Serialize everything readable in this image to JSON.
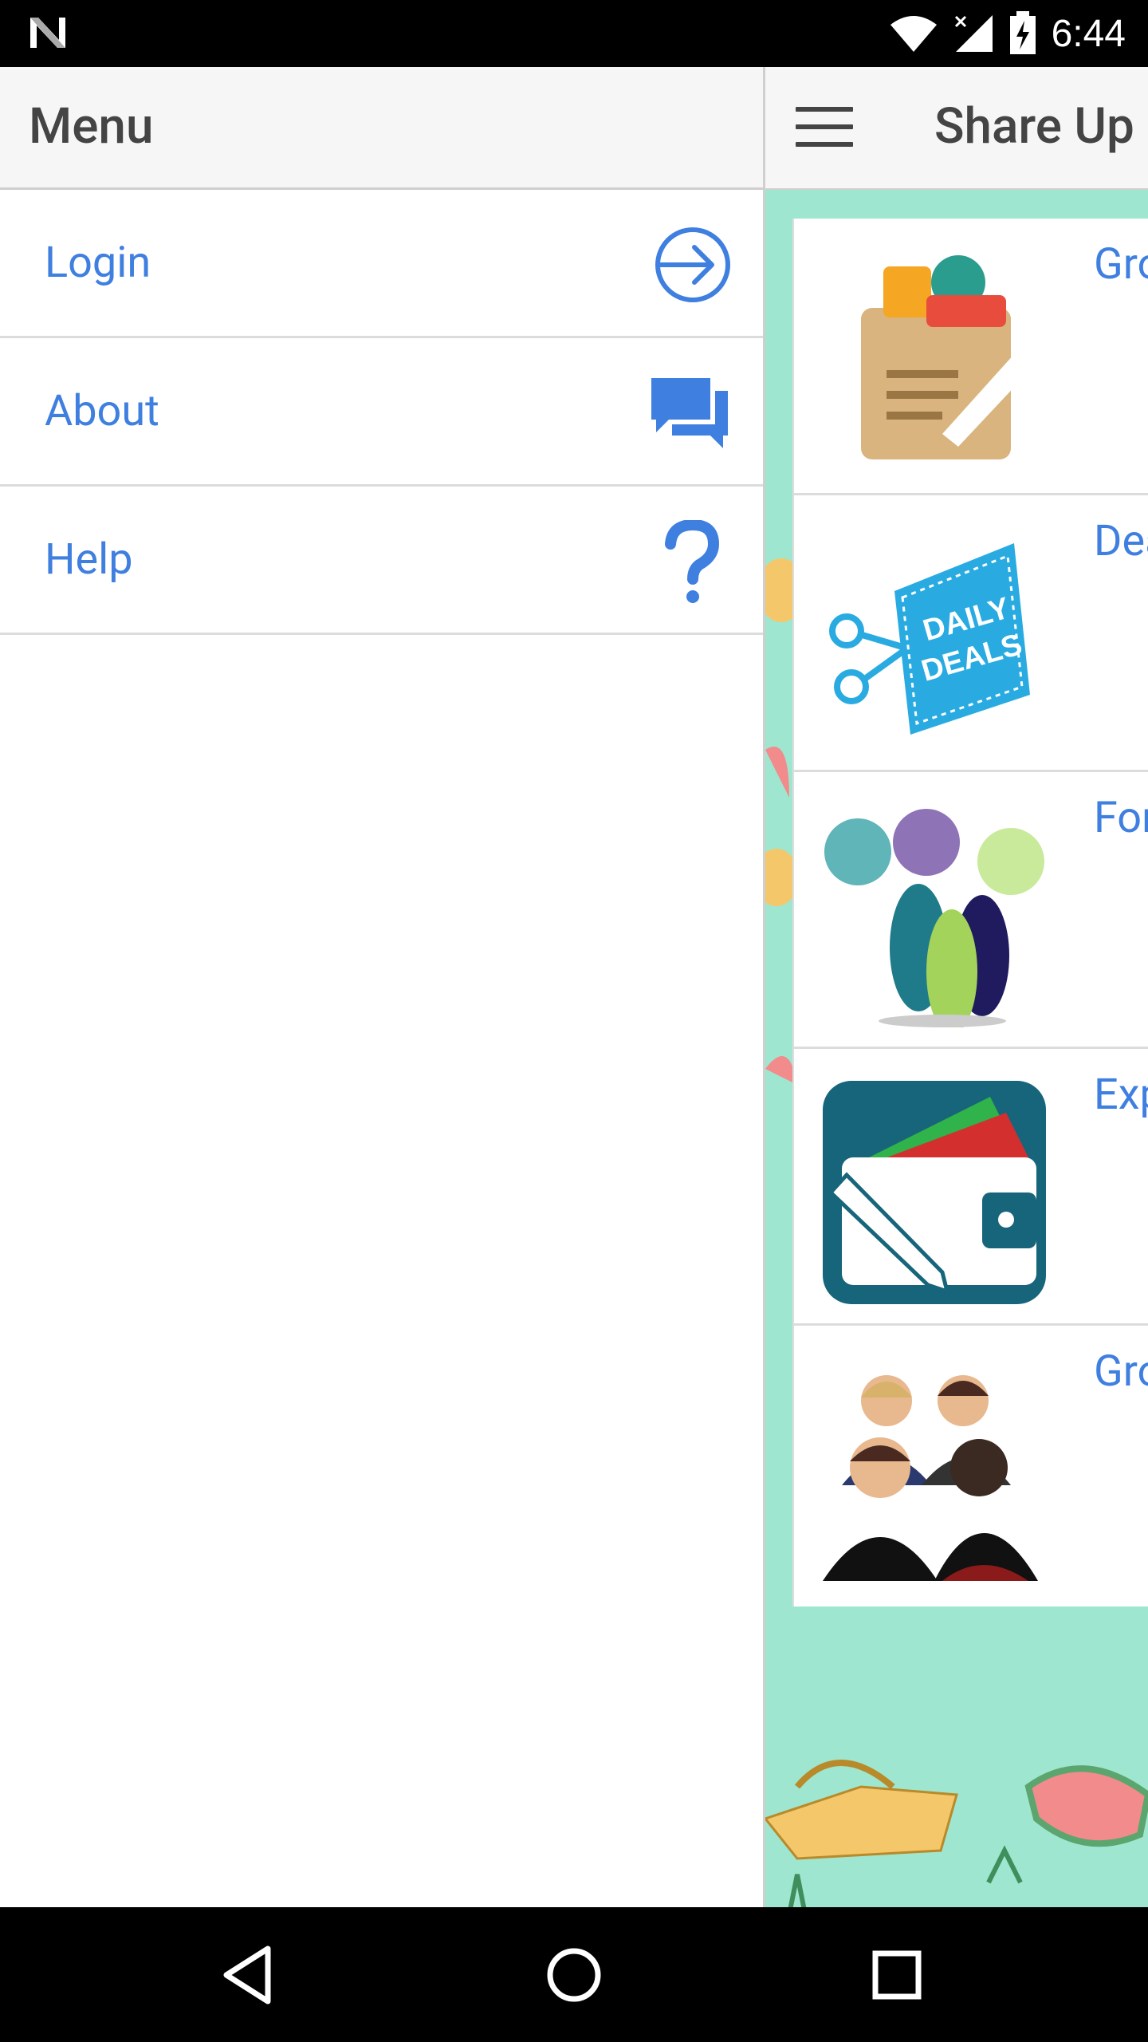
{
  "status_bar": {
    "time": "6:44",
    "icons": [
      "n-logo-icon",
      "wifi-icon",
      "signal-icon",
      "battery-charging-icon"
    ]
  },
  "app": {
    "title": "Share Up",
    "colors": {
      "accent": "#3f7fe0",
      "toolbar": "#f6f6f6",
      "background": "#9fe6d0"
    },
    "cards": [
      {
        "label": "Gro",
        "icon": "grocery-bag-icon"
      },
      {
        "label": "Dea",
        "icon": "daily-deals-icon"
      },
      {
        "label": "For",
        "icon": "forum-people-icon"
      },
      {
        "label": "Exp",
        "icon": "wallet-expense-icon"
      },
      {
        "label": "Gro",
        "icon": "group-people-icon"
      }
    ]
  },
  "drawer": {
    "title": "Menu",
    "items": [
      {
        "label": "Login",
        "icon": "login-arrow-icon"
      },
      {
        "label": "About",
        "icon": "chat-bubbles-icon"
      },
      {
        "label": "Help",
        "icon": "question-mark-icon"
      }
    ]
  },
  "nav_bar": {
    "buttons": [
      "back-icon",
      "home-icon",
      "recents-icon"
    ]
  }
}
